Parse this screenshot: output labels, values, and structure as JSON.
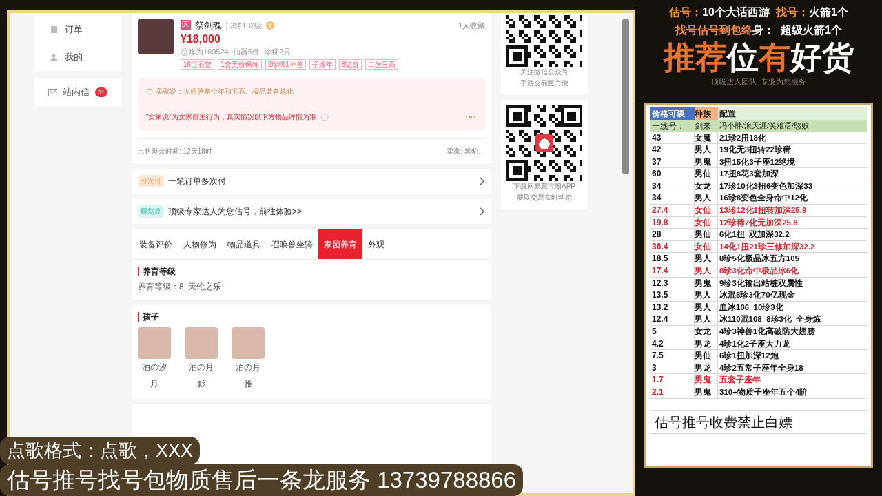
{
  "sidebar": {
    "items": [
      {
        "label": "订单"
      },
      {
        "label": "我的"
      },
      {
        "label": "站内信",
        "badge": "31"
      }
    ]
  },
  "item": {
    "server_tag": "区",
    "name": "祭剑魂",
    "level": "3转182级",
    "favorites": "1人收藏",
    "price": "¥18,000",
    "stats": "总修为169524  仙器5件  珍稀2只",
    "tags": [
      "16宝石套",
      "1套无价佩饰",
      "2珍稀1神兽",
      "子虚年",
      "8隐身",
      "二坐三高"
    ],
    "seller_says": "卖家说：大翅膀差个年和宝石。极品装备炼化",
    "disclaimer": "“卖家说”为卖家自主行为，真实情况以下方物品详情为准",
    "time_left": "出售剩余时间: 12天18时",
    "seller": "卖家: 黑豹。"
  },
  "promos": [
    {
      "badge": "分次付",
      "kind": "pay",
      "text": "一笔订单多次付"
    },
    {
      "badge": "藏划算",
      "kind": "deal",
      "text": "顶级专家达人为您估号，前往体验>>"
    }
  ],
  "tabs": [
    {
      "label": "装备评价",
      "selected": false
    },
    {
      "label": "人物修为",
      "selected": false
    },
    {
      "label": "物品道具",
      "selected": false
    },
    {
      "label": "召唤兽坐骑",
      "selected": false
    },
    {
      "label": "家园养育",
      "selected": true
    },
    {
      "label": "外观",
      "selected": false
    }
  ],
  "breeding": {
    "title": "养育等级",
    "text": "养育等级：8  天伦之乐"
  },
  "children": {
    "title": "孩子",
    "items": [
      {
        "name": "泊の汐月"
      },
      {
        "name": "泊の月影"
      },
      {
        "name": "泊の月雅"
      }
    ]
  },
  "qr_cards": [
    {
      "lines": [
        "关注微信公众号",
        "手游交易更方便"
      ],
      "logo": false
    },
    {
      "lines": [
        "下载网易藏宝阁APP",
        "获取交易实时动态"
      ],
      "logo": true
    }
  ],
  "promo_panel": {
    "line1": [
      {
        "text": "估号：",
        "accent": true
      },
      {
        "text": "10个大话西游",
        "accent": false
      },
      {
        "text": "  找号：",
        "accent": true
      },
      {
        "text": "火箭1个",
        "accent": false
      }
    ],
    "line2": [
      {
        "text": "找号估号到包终",
        "accent": true
      },
      {
        "text": "身：  超级火箭1个",
        "accent": false
      }
    ],
    "headline": [
      {
        "text": "推荐",
        "accent": true
      },
      {
        "text": "位",
        "accent": false
      },
      {
        "text": "有",
        "accent": true
      },
      {
        "text": "好货",
        "accent": false
      }
    ],
    "subtitle": "顶级达人团队  专业为您服务"
  },
  "sheet": {
    "header": [
      "价格可谈",
      "种族",
      "配置"
    ],
    "subheader": [
      "一线号：",
      "剑来",
      "冯小胖/浪天涯/笑难语/憨败"
    ],
    "rows": [
      {
        "price": "43",
        "race": "女魔",
        "config": "21珍2扭18化",
        "kind": "normal"
      },
      {
        "price": "42",
        "race": "男人",
        "config": "19化无3扭转22珍稀",
        "kind": "normal"
      },
      {
        "price": "37",
        "race": "男鬼",
        "config": "3扭15化3子座12绝境",
        "kind": "normal"
      },
      {
        "price": "60",
        "race": "男仙",
        "config": "17扭8花3套加深",
        "kind": "normal"
      },
      {
        "price": "34",
        "race": "女龙",
        "config": "17珍10化3扭6变色加深33",
        "kind": "normal"
      },
      {
        "price": "34",
        "race": "男人",
        "config": "16珍8变色全身命中12化",
        "kind": "normal"
      },
      {
        "price": "27.4",
        "race": "女仙",
        "config": "13珍12化1扭转加深25.9",
        "kind": "red"
      },
      {
        "price": "19.8",
        "race": "女仙",
        "config": "12珍稀7化无加深25.8",
        "kind": "red"
      },
      {
        "price": "28",
        "race": "男仙",
        "config": "6化1扭  双加深32.2",
        "kind": "normal"
      },
      {
        "price": "36.4",
        "race": "女仙",
        "config": "14化1扭21珍三修加深32.2",
        "kind": "red"
      },
      {
        "price": "18.5",
        "race": "男人",
        "config": "8珍5化极品冰五方105",
        "kind": "normal"
      },
      {
        "price": "17.4",
        "race": "男人",
        "config": "8珍3化命中极品冰6化",
        "kind": "red"
      },
      {
        "price": "12.3",
        "race": "男鬼",
        "config": "9珍3化输出站桩双属性",
        "kind": "normal"
      },
      {
        "price": "13.5",
        "race": "男人",
        "config": "冰混8珍3化70亿现金",
        "kind": "normal"
      },
      {
        "price": "13.2",
        "race": "男人",
        "config": "血冰106  10珍3化",
        "kind": "normal"
      },
      {
        "price": "12.4",
        "race": "男人",
        "config": "冰110混108  8珍3化  全身炼",
        "kind": "normal"
      },
      {
        "price": "5",
        "race": "女龙",
        "config": "4珍3神兽1化高破防大翅膀",
        "kind": "normal"
      },
      {
        "price": "4.2",
        "race": "男龙",
        "config": "4珍1化2子座大力龙",
        "kind": "normal"
      },
      {
        "price": "7.5",
        "race": "男仙",
        "config": "6珍1扭加深12炮",
        "kind": "normal"
      },
      {
        "price": "3",
        "race": "男龙",
        "config": "4珍2五常子座年全身18",
        "kind": "normal"
      },
      {
        "price": "1.7",
        "race": "男鬼",
        "config": "五套子座年",
        "kind": "red"
      },
      {
        "price": "2.1",
        "race": "男鬼",
        "config": "310+物质子座年五个4阶",
        "kind": "price-red"
      }
    ],
    "notice": "估号推号收费禁止白嫖"
  },
  "captions": [
    "点歌格式：点歌，XXX",
    "估号推号找号包物质售后一条龙服务 13739788866"
  ]
}
